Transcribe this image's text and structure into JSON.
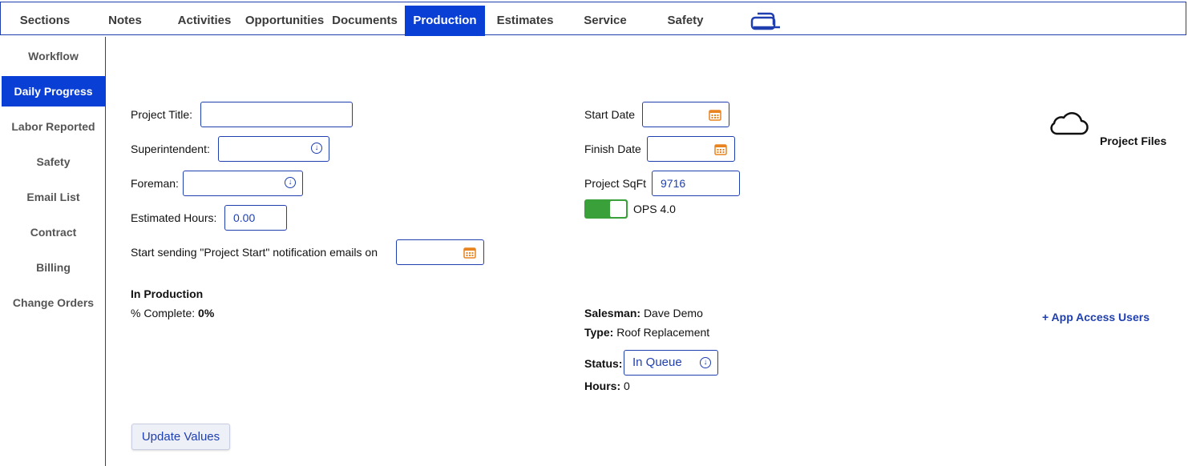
{
  "nav": {
    "tabs": [
      "Sections",
      "Notes",
      "Activities",
      "Opportunities",
      "Documents",
      "Production",
      "Estimates",
      "Service",
      "Safety"
    ],
    "active": "Production",
    "icon": "stacked-windows-icon"
  },
  "sidebar": {
    "items": [
      "Workflow",
      "Daily Progress",
      "Labor Reported",
      "Safety",
      "Email List",
      "Contract",
      "Billing",
      "Change Orders"
    ],
    "active": "Daily Progress"
  },
  "form": {
    "project_title_label": "Project Title:",
    "project_title_value": "",
    "superintendent_label": "Superintendent:",
    "foreman_label": "Foreman:",
    "estimated_hours_label": "Estimated Hours:",
    "estimated_hours_value": "0.00",
    "notify_label": "Start sending \"Project Start\" notification emails on",
    "start_date_label": "Start Date",
    "finish_date_label": "Finish Date",
    "sqft_label": "Project SqFt",
    "sqft_value": "9716",
    "ops_label": "OPS 4.0",
    "ops_enabled": true
  },
  "status": {
    "in_production": "In Production",
    "complete_label": "% Complete:",
    "complete_value": "0%",
    "salesman_label": "Salesman:",
    "salesman_value": "Dave Demo",
    "type_label": "Type:",
    "type_value": "Roof Replacement",
    "status_label": "Status:",
    "status_value": "In Queue",
    "hours_label": "Hours:",
    "hours_value": "0"
  },
  "files": {
    "label": "Project Files",
    "icon": "cloud-icon"
  },
  "app_access_link": "+ App Access Users",
  "update_button": "Update Values",
  "colors": {
    "accent": "#0a3fd6",
    "toggle_on": "#3aa03a",
    "calendar": "#e8831e"
  }
}
